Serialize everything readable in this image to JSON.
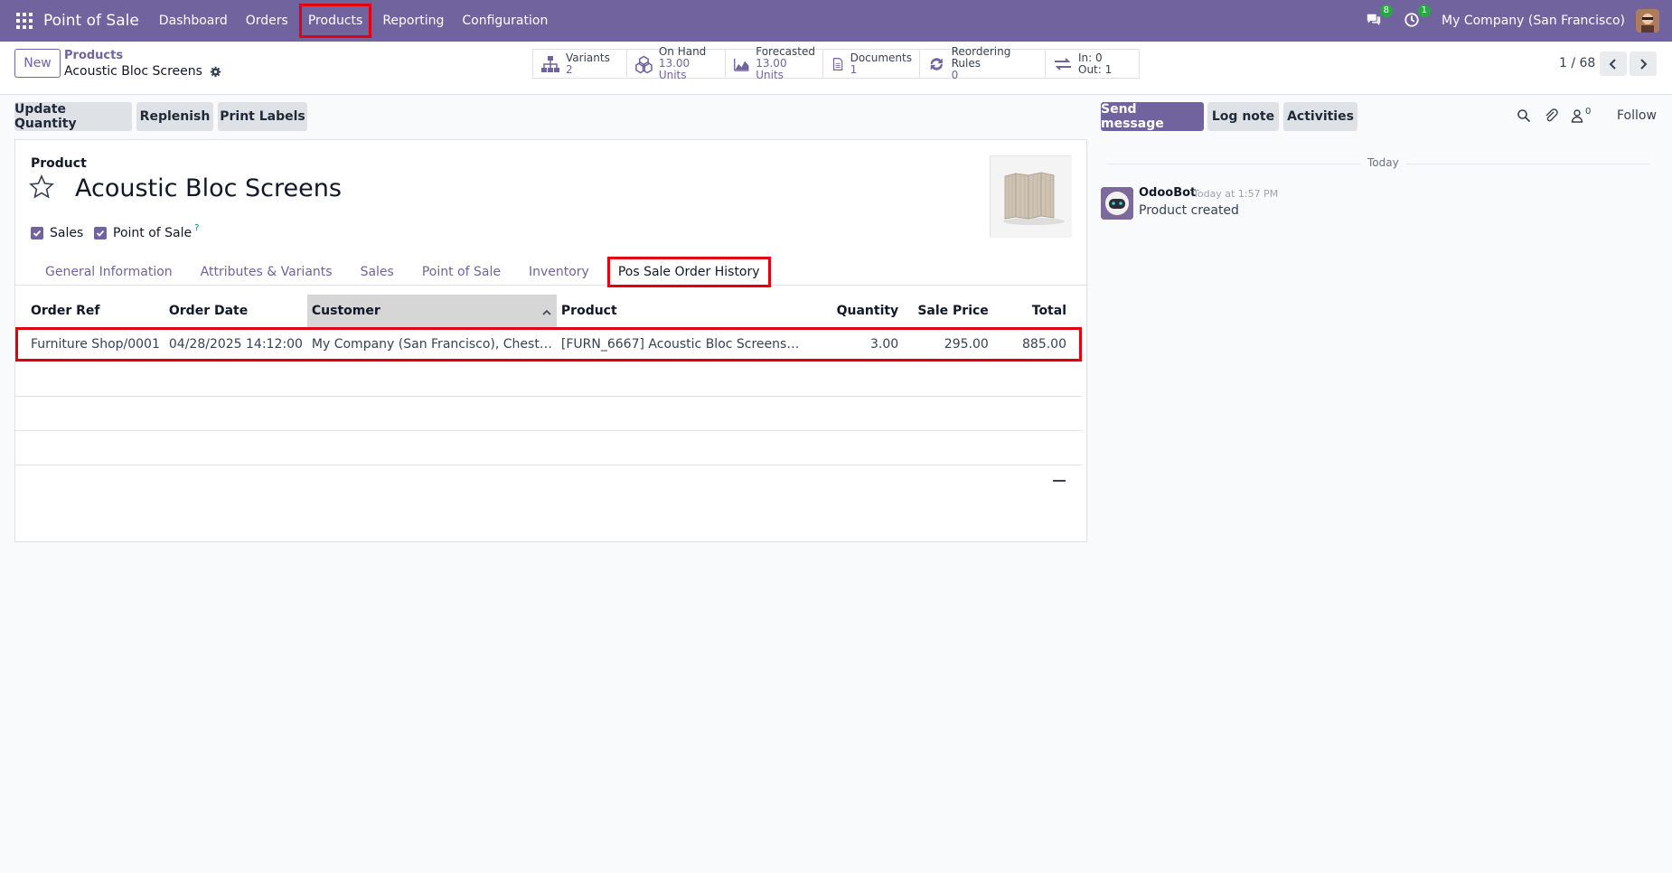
{
  "navbar": {
    "app_name": "Point of Sale",
    "menu": [
      "Dashboard",
      "Orders",
      "Products",
      "Reporting",
      "Configuration"
    ],
    "messages_count": "8",
    "activities_count": "1",
    "company": "My Company (San Francisco)"
  },
  "control": {
    "new_label": "New",
    "breadcrumb_parent": "Products",
    "breadcrumb_current": "Acoustic Bloc Screens",
    "pager": "1 / 68",
    "smart_buttons": [
      {
        "label": "Variants",
        "value": "2",
        "icon": "variants-icon"
      },
      {
        "label": "On Hand",
        "value": "13.00 Units",
        "icon": "boxes-icon"
      },
      {
        "label": "Forecasted",
        "value": "13.00 Units",
        "icon": "area-chart-icon"
      },
      {
        "label": "Documents",
        "value": "1",
        "icon": "document-icon"
      },
      {
        "label": "Reordering Rules",
        "value": "0",
        "icon": "refresh-icon"
      },
      {
        "label": "In: 0",
        "value": "Out: 1",
        "icon": "exchange-icon"
      }
    ]
  },
  "actions": {
    "update_qty": "Update Quantity",
    "replenish": "Replenish",
    "print_labels": "Print Labels"
  },
  "form": {
    "product_label": "Product",
    "product_name": "Acoustic Bloc Screens",
    "sales_label": "Sales",
    "pos_label": "Point of Sale",
    "help_mark": "?",
    "tabs": [
      "General Information",
      "Attributes & Variants",
      "Sales",
      "Point of Sale",
      "Inventory",
      "Pos Sale Order History"
    ],
    "active_tab": "Pos Sale Order History",
    "table": {
      "headers": [
        "Order Ref",
        "Order Date",
        "Customer",
        "Product",
        "Quantity",
        "Sale Price",
        "Total"
      ],
      "rows": [
        [
          "Furniture Shop/0001",
          "04/28/2025 14:12:00",
          "My Company (San Francisco), Chester R…",
          "[FURN_6667] Acoustic Bloc Screens…",
          "3.00",
          "295.00",
          "885.00"
        ]
      ]
    }
  },
  "chatter": {
    "send_message": "Send message",
    "log_note": "Log note",
    "activities": "Activities",
    "followers_count": "0",
    "follow": "Follow",
    "date_separator": "Today",
    "author": "OdooBot",
    "time": "Today at 1:57 PM",
    "body": "Product created"
  },
  "colors": {
    "brand": "#71639e",
    "highlight": "#e00010",
    "badge": "#28a745"
  }
}
